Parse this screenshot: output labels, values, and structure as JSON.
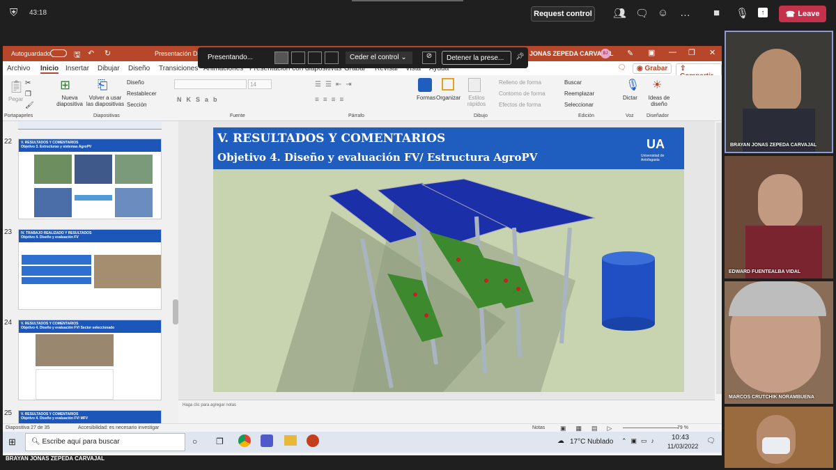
{
  "teams": {
    "timer": "43:18",
    "request_control": "Request control",
    "leave": "Leave"
  },
  "ppt": {
    "autosave": "Autoguardado",
    "doc_title": "Presentación Defe",
    "user": "JONAS ZEPEDA CARVAJAL",
    "user_initials": "BJ",
    "tabs": [
      "Archivo",
      "Inicio",
      "Insertar",
      "Dibujar",
      "Diseño",
      "Transiciones",
      "Animaciones",
      "Presentación con diapositivas",
      "Grabar",
      "Revisar",
      "Vista",
      "Ayuda"
    ],
    "grabar_btn": "Grabar",
    "compartir_btn": "Compartir",
    "ribbon": {
      "pegar": "Pegar",
      "nueva_diapositiva": "Nueva diapositiva",
      "volver_usar": "Volver a usar las diapositivas",
      "diseno": "Diseño",
      "restablecer": "Restablecer",
      "seccion": "Sección",
      "font_size": "14",
      "formas": "Formas",
      "organizar": "Organizar",
      "estilos_rapidos": "Estilos rápidos",
      "relleno": "Relleno de forma",
      "contorno": "Contorno de forma",
      "efectos": "Efectos de forma",
      "buscar": "Buscar",
      "reemplazar": "Reemplazar",
      "seleccionar": "Seleccionar",
      "dictar": "Dictar",
      "ideas": "Ideas de diseño",
      "groups": [
        "Portapapeles",
        "Diapositivas",
        "Fuente",
        "Párrafo",
        "Dibujo",
        "Edición",
        "Voz",
        "Diseñador"
      ]
    },
    "presenting_bar": {
      "presenting": "Presentando...",
      "ceder": "Ceder el control",
      "detener": "Detener la prese..."
    },
    "thumbnails": [
      {
        "num": "22",
        "title": "V. RESULTADOS Y COMENTARIOS",
        "subtitle": "Objetivo 3. Estructuras y sistemas AgroPV"
      },
      {
        "num": "23",
        "title": "IV. TRABAJO REALIZADO Y RESULTADOS",
        "subtitle": "Objetivo 4. Diseño y evaluación FV"
      },
      {
        "num": "24",
        "title": "V. RESULTADOS Y COMENTARIOS",
        "subtitle": "Objetivo 4. Diseño y evaluación FV/ Sector seleccionado"
      },
      {
        "num": "25",
        "title": "V. RESULTADOS Y COMENTARIOS",
        "subtitle": "Objetivo 4. Diseño y evaluación FV/ MFV"
      }
    ],
    "slide": {
      "title": "V. RESULTADOS Y COMENTARIOS",
      "subtitle": "Objetivo 4. Diseño y evaluación FV/ Estructura AgroPV",
      "logo": "UA",
      "logo_sub": "Universidad de Antofagasta"
    },
    "notes_placeholder": "Haga clic para agregar notas",
    "status": {
      "slide": "Diapositiva 27 de 35",
      "accessibility": "Accesibilidad: es necesario investigar",
      "notas": "Notas",
      "zoom": "79 %"
    },
    "taskbar": {
      "search": "Escribe aquí para buscar",
      "weather": "17°C  Nublado",
      "time": "10:43",
      "date": "11/03/2022"
    }
  },
  "presenter_label": "BRAYAN JONAS ZEPEDA CARVAJAL",
  "participants": [
    {
      "name": "BRAYAN JONAS ZEPEDA CARVAJAL"
    },
    {
      "name": "EDWARD FUENTEALBA VIDAL"
    },
    {
      "name": "MARCOS CRUTCHIK NORAMBUENA"
    },
    {
      "name": ""
    }
  ],
  "colors": {
    "ppt_red": "#b7472a",
    "slide_blue": "#1f5dbe",
    "leave_red": "#c4314b"
  }
}
